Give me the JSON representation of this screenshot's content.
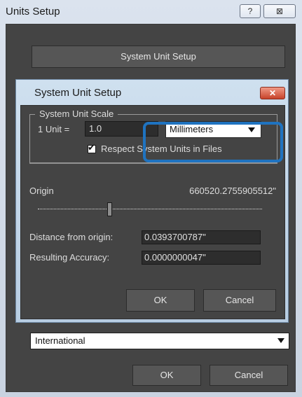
{
  "outer": {
    "title": "Units Setup",
    "help_label": "?",
    "close_label": "⊠",
    "system_unit_setup_button": "System Unit Setup",
    "lighting_units": {
      "selected": "International"
    },
    "ok_label": "OK",
    "cancel_label": "Cancel"
  },
  "inner": {
    "title": "System Unit Setup",
    "close_label": "✕",
    "scale_group_label": "System Unit Scale",
    "unit_label": "1 Unit =",
    "unit_value": "1.0",
    "unit_type": {
      "selected": "Millimeters"
    },
    "respect_label": "Respect System Units in Files",
    "respect_checked": true,
    "checkmark": "✔",
    "origin_label": "Origin",
    "origin_value": "660520.2755905512\"",
    "origin_slider_level": 0.32,
    "distance_label": "Distance from origin:",
    "distance_value": "0.0393700787\"",
    "accuracy_label": "Resulting Accuracy:",
    "accuracy_value": "0.0000000047\"",
    "ok_label": "OK",
    "cancel_label": "Cancel"
  },
  "colors": {
    "panel_bg": "#444444",
    "highlight": "#1f73c0",
    "title_bar": "#d5dde8"
  }
}
